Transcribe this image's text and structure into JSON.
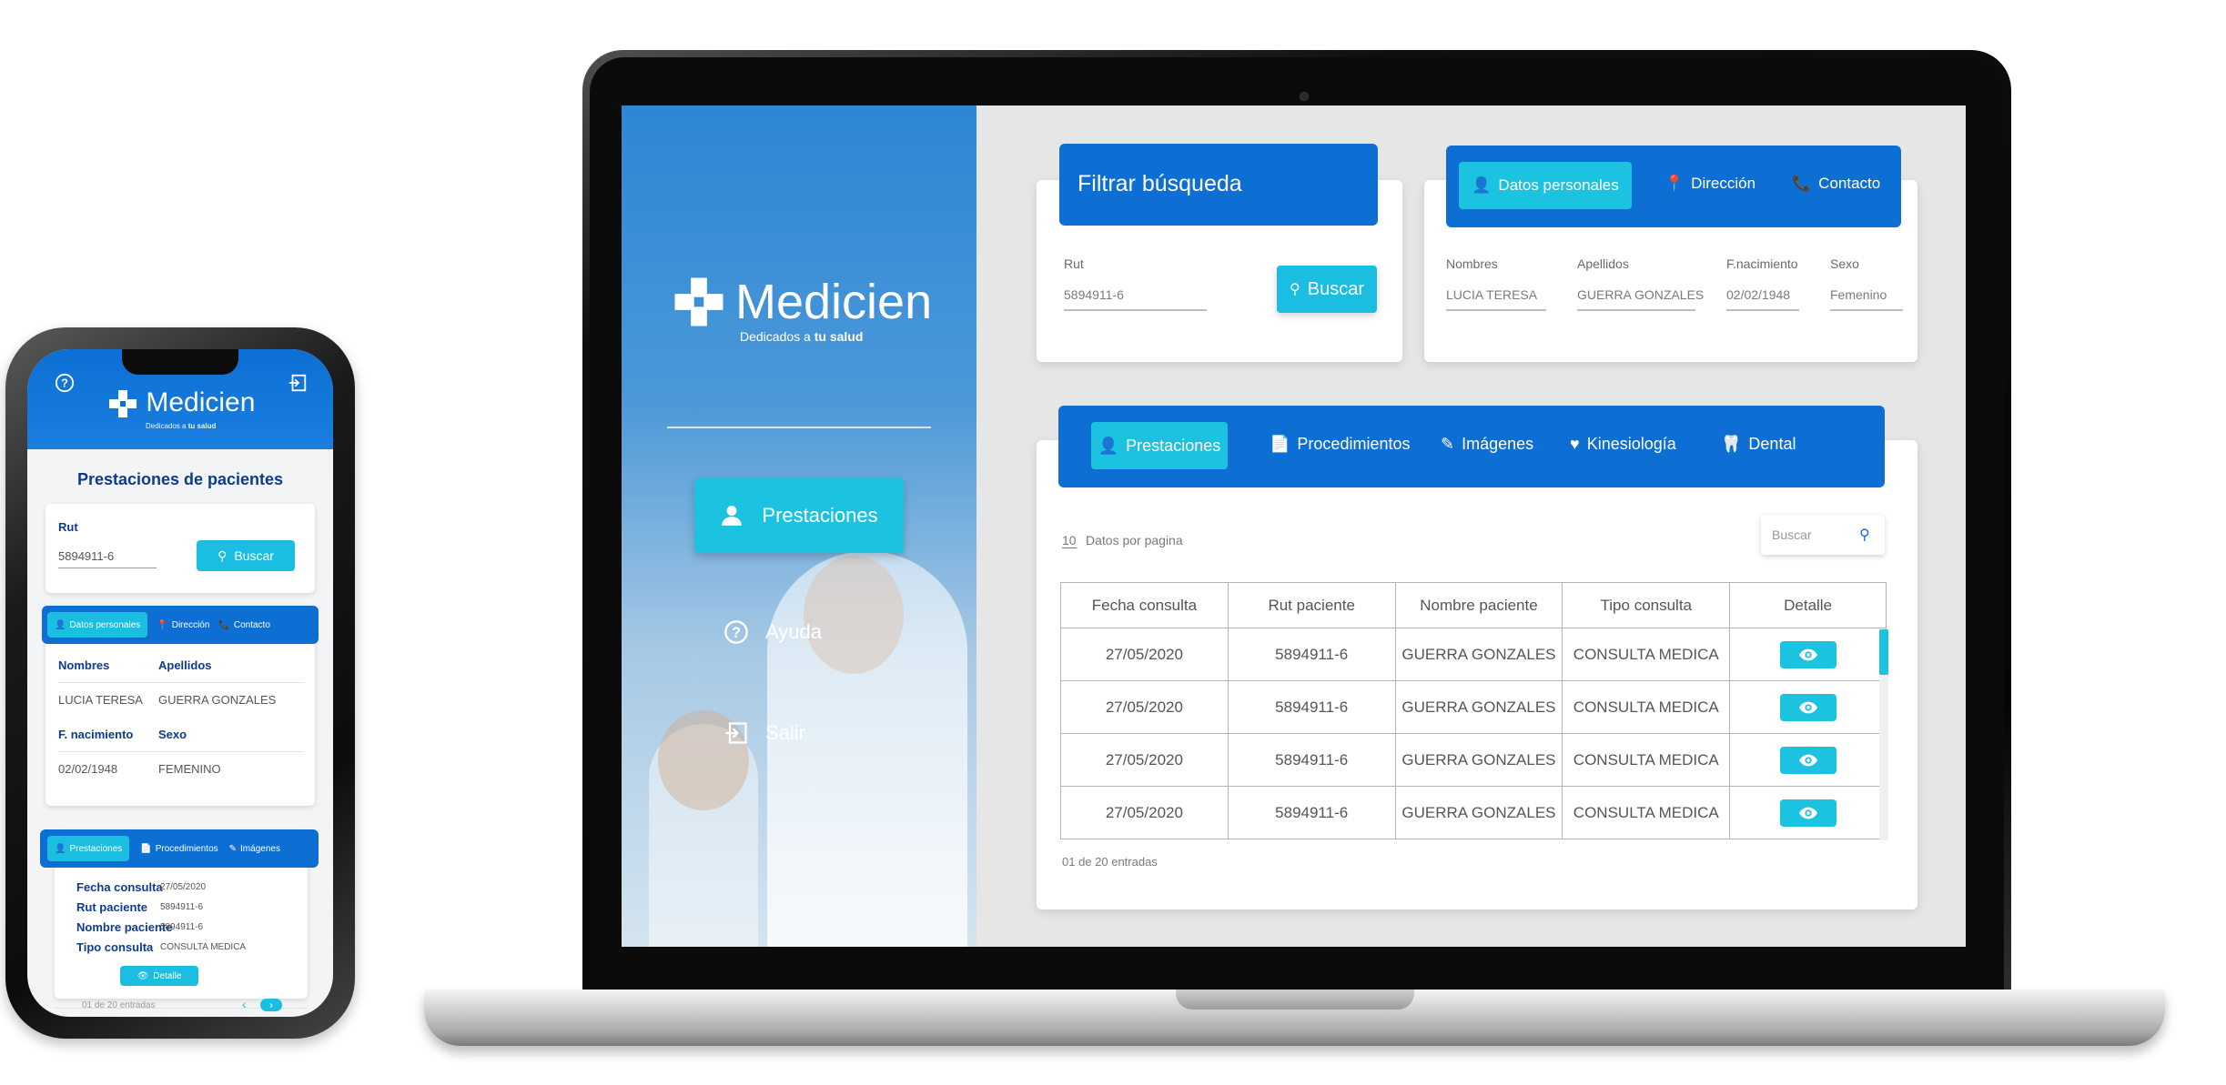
{
  "brand": {
    "name": "Medicien",
    "tagline_prefix": "Dedicados a ",
    "tagline_bold": "tu salud"
  },
  "colors": {
    "primary": "#0d6fd4",
    "accent": "#1bc3e0",
    "title_text": "#0d3b8e"
  },
  "phone": {
    "title": "Prestaciones de pacientes",
    "search": {
      "rut_label": "Rut",
      "rut_value": "5894911-6",
      "button": "Buscar"
    },
    "info_tabs": [
      "Datos personales",
      "Dirección",
      "Contacto"
    ],
    "personal": {
      "nombres_label": "Nombres",
      "apellidos_label": "Apellidos",
      "nombres": "LUCIA TERESA",
      "apellidos": "GUERRA GONZALES",
      "nacimiento_label": "F. nacimiento",
      "sexo_label": "Sexo",
      "nacimiento": "02/02/1948",
      "sexo": "FEMENINO"
    },
    "service_tabs": [
      "Prestaciones",
      "Procedimientos",
      "Imágenes"
    ],
    "record": {
      "fecha_label": "Fecha consulta",
      "fecha": "27/05/2020",
      "rut_label": "Rut paciente",
      "rut": "5894911-6",
      "nombre_label": "Nombre paciente",
      "nombre": "5894911-6",
      "tipo_label": "Tipo consulta",
      "tipo": "CONSULTA MEDICA"
    },
    "detalle_button": "Detalle",
    "pagination_text": "01 de 20 entradas",
    "prev": "‹",
    "next": "›"
  },
  "laptop": {
    "nav": {
      "prestaciones": "Prestaciones",
      "ayuda": "Ayuda",
      "salir": "Salir"
    },
    "filter": {
      "title": "Filtrar búsqueda",
      "rut_label": "Rut",
      "rut_value": "5894911-6",
      "button": "Buscar"
    },
    "info_tabs": [
      "Datos personales",
      "Dirección",
      "Contacto"
    ],
    "personal": {
      "nombres_label": "Nombres",
      "nombres": "LUCIA TERESA",
      "apellidos_label": "Apellidos",
      "apellidos": "GUERRA GONZALES",
      "nacimiento_label": "F.nacimiento",
      "nacimiento": "02/02/1948",
      "sexo_label": "Sexo",
      "sexo": "Femenino"
    },
    "service_tabs": [
      "Prestaciones",
      "Procedimientos",
      "Imágenes",
      "Kinesiología",
      "Dental"
    ],
    "per_page_value": "10",
    "per_page_label": "Datos por pagina",
    "search_placeholder": "Buscar",
    "table": {
      "headers": [
        "Fecha consulta",
        "Rut paciente",
        "Nombre paciente",
        "Tipo consulta",
        "Detalle"
      ],
      "rows": [
        [
          "27/05/2020",
          "5894911-6",
          "GUERRA GONZALES",
          "CONSULTA MEDICA"
        ],
        [
          "27/05/2020",
          "5894911-6",
          "GUERRA GONZALES",
          "CONSULTA MEDICA"
        ],
        [
          "27/05/2020",
          "5894911-6",
          "GUERRA GONZALES",
          "CONSULTA MEDICA"
        ],
        [
          "27/05/2020",
          "5894911-6",
          "GUERRA GONZALES",
          "CONSULTA MEDICA"
        ]
      ]
    },
    "entries_text": "01 de 20 entradas"
  }
}
